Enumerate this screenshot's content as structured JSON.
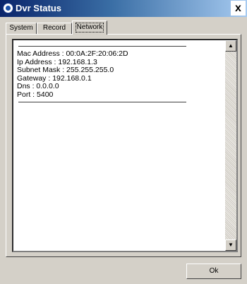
{
  "window": {
    "title": "Dvr Status",
    "close_label": "x",
    "icon": "app-logo-icon"
  },
  "tabs": [
    {
      "label": "System",
      "selected": false
    },
    {
      "label": "Record",
      "selected": false
    },
    {
      "label": "Network",
      "selected": true
    }
  ],
  "network": {
    "lines": [
      "Mac Address : 00:0A:2F:20:06:2D",
      "Ip Address : 192.168.1.3",
      "Subnet Mask : 255.255.255.0",
      "Gateway : 192.168.0.1",
      "Dns : 0.0.0.0",
      "Port : 5400"
    ]
  },
  "scrollbar": {
    "up_glyph": "▲",
    "down_glyph": "▼"
  },
  "footer": {
    "ok_label": "Ok"
  }
}
